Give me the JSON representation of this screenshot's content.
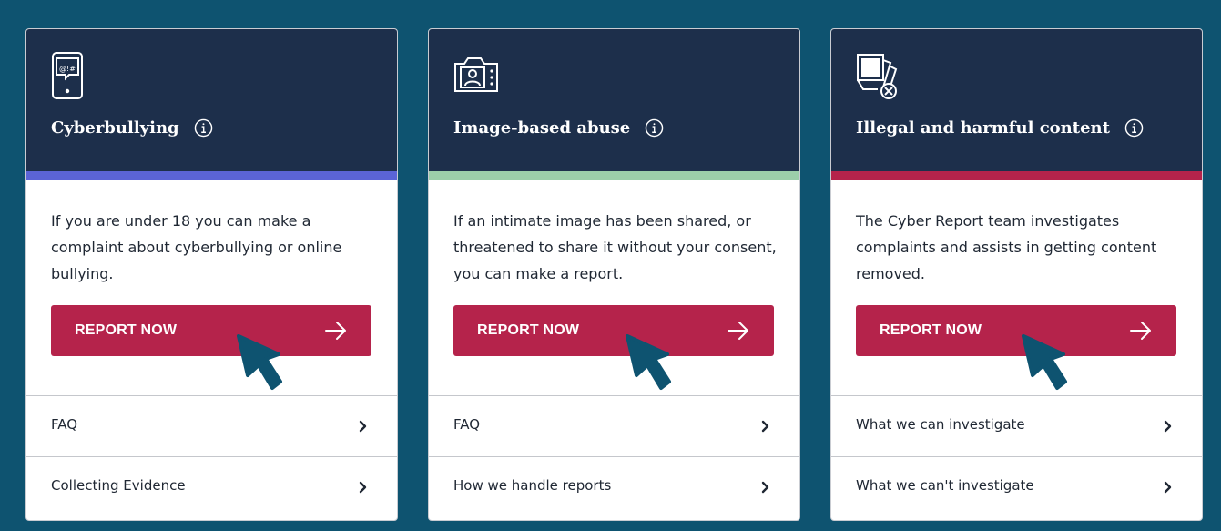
{
  "theme": {
    "page_bg": "#0e5370",
    "header_bg": "#1d2f4b",
    "button_bg": "#b5234b",
    "cursor_color": "#0e5370"
  },
  "cards": [
    {
      "title": "Cyberbullying",
      "icon": "phone-chat-icon",
      "accent_color": "#5b64d6",
      "description": "If you are under 18 you can make a complaint about cyberbullying or online bullying.",
      "button_label": "REPORT NOW",
      "links": [
        "FAQ",
        "Collecting Evidence"
      ]
    },
    {
      "title": "Image-based abuse",
      "icon": "camera-person-icon",
      "accent_color": "#9cceaa",
      "description": "If an intimate image has been shared, or threatened to share it without your consent, you can make a report.",
      "button_label": "REPORT NOW",
      "links": [
        "FAQ",
        "How we handle reports"
      ]
    },
    {
      "title": "Illegal and harmful content",
      "icon": "blocked-images-icon",
      "accent_color": "#b5234b",
      "description": "The Cyber Report team investigates complaints and assists in getting content removed.",
      "button_label": "REPORT NOW",
      "links": [
        "What we can investigate",
        "What we can't investigate"
      ]
    }
  ]
}
